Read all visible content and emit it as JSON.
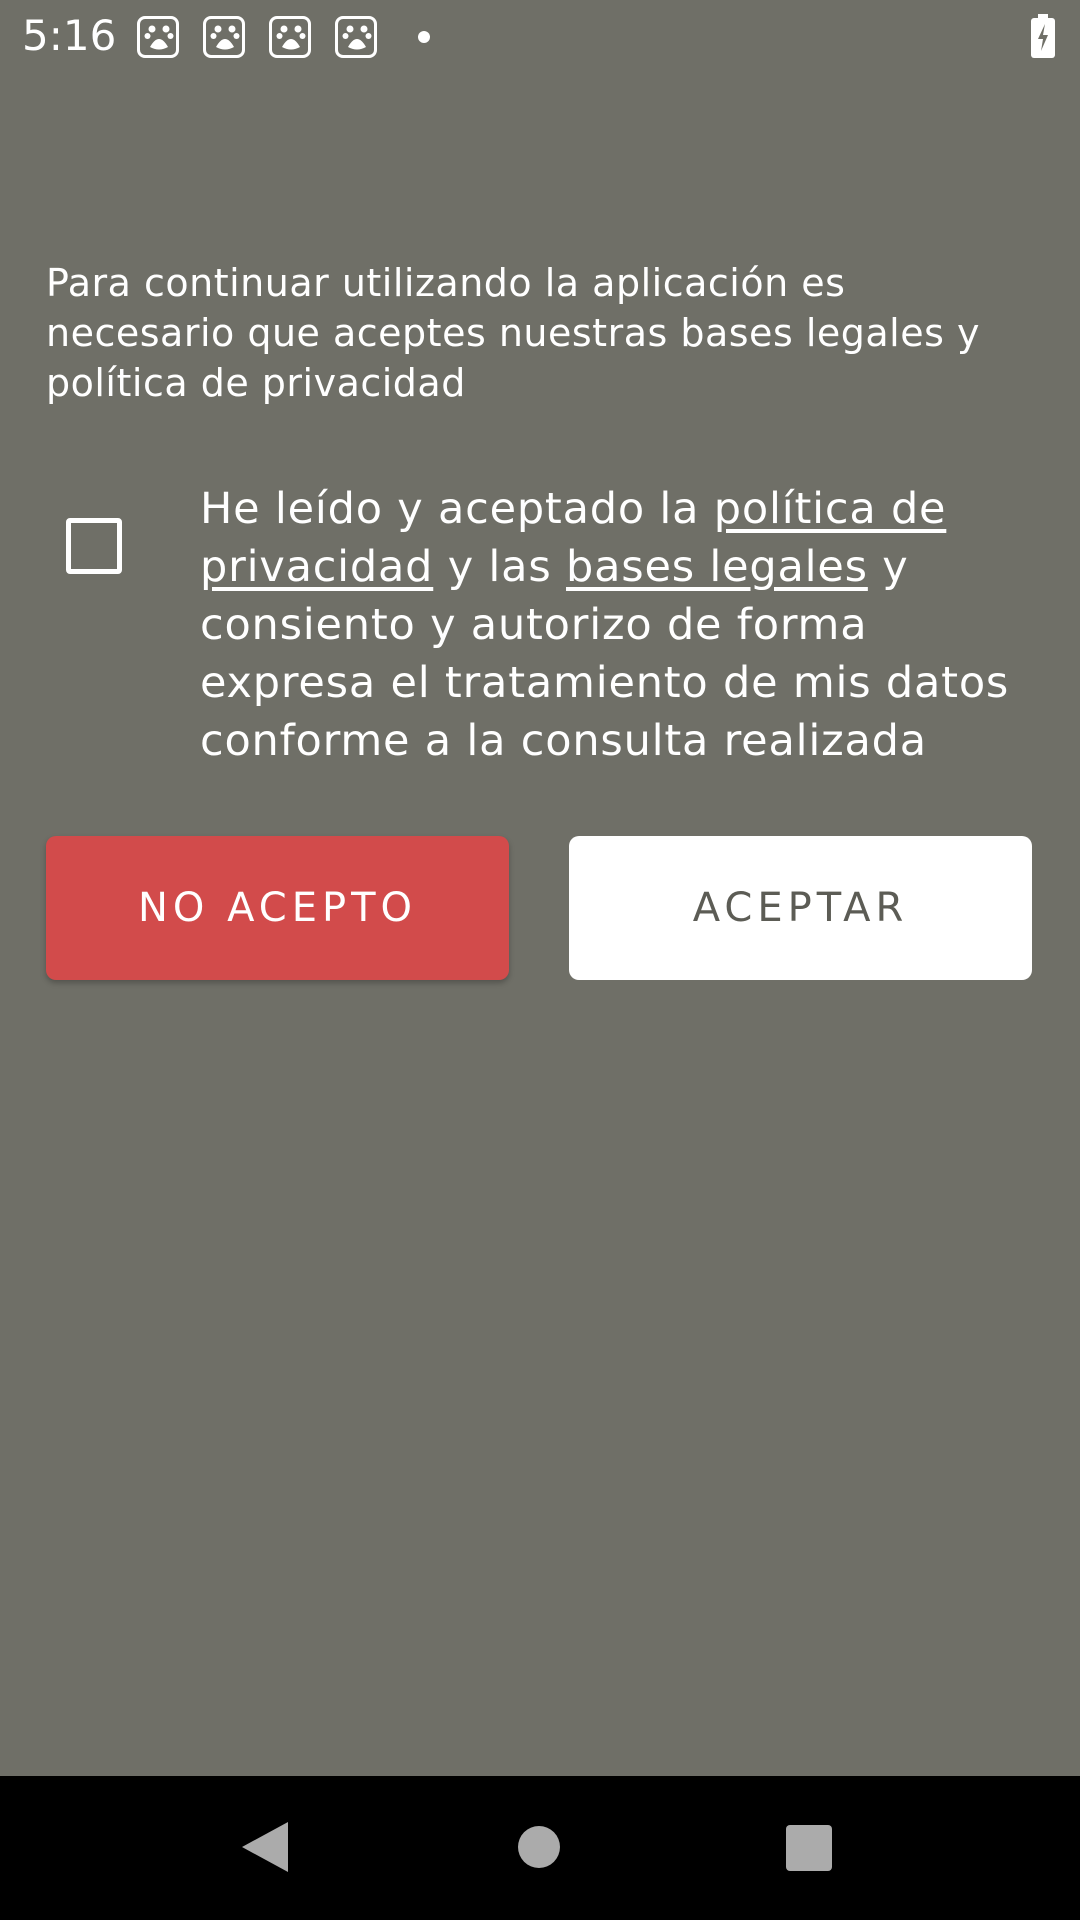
{
  "status_bar": {
    "time": "5:16",
    "notification_icons": [
      "baidu-paw-icon",
      "baidu-paw-icon",
      "baidu-paw-icon",
      "baidu-paw-icon"
    ],
    "battery_icon": "battery-charging-icon"
  },
  "intro": {
    "text": "Para continuar utilizando la aplicación es necesario que aceptes nuestras bases legales y política de privacidad"
  },
  "consent": {
    "checked": false,
    "text_1": "He leído y aceptado la ",
    "privacy_link": "política de privacidad",
    "text_2": " y las ",
    "legal_link": "bases legales",
    "text_3": " y consiento y autorizo de forma expresa el tratamiento de mis datos conforme a la consulta realizada"
  },
  "buttons": {
    "decline_label": "NO ACEPTO",
    "accept_label": "ACEPTAR"
  },
  "colors": {
    "background": "#6f6f67",
    "decline": "#d24b4b",
    "accept": "#ffffff"
  },
  "nav_bar": {
    "back_icon": "back-triangle-icon",
    "home_icon": "home-circle-icon",
    "recents_icon": "recents-square-icon"
  }
}
